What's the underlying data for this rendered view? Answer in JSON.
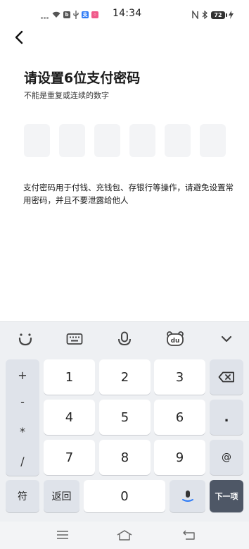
{
  "status_bar": {
    "time": "14:34",
    "battery": "72"
  },
  "header": {
    "title": "请设置6位支付密码",
    "subtitle": "不能是重复或连续的数字"
  },
  "pin": {
    "length": 6,
    "filled": 0
  },
  "description": "支付密码用于付钱、充钱包、存银行等操作，请避免设置常用密码，并且不要泄露给他人",
  "keyboard": {
    "toolbar_icons": [
      "emoji-icon",
      "keyboard-icon",
      "microphone-icon",
      "du-bear-icon",
      "chevron-down-icon"
    ],
    "symbols": [
      "+",
      "-",
      "*",
      "/"
    ],
    "digits": [
      "1",
      "2",
      "3",
      "4",
      "5",
      "6",
      "7",
      "8",
      "9",
      "0"
    ],
    "dot": ".",
    "at": "@",
    "symbol_key": "符",
    "back_key": "返回",
    "next_key": "下一项"
  },
  "colors": {
    "keyboard_bg": "#eef0f3",
    "key_bg": "#ffffff",
    "function_key_bg": "#dfe3ea",
    "next_key_bg": "#4e5766",
    "pin_box_bg": "#f3f4f6"
  }
}
